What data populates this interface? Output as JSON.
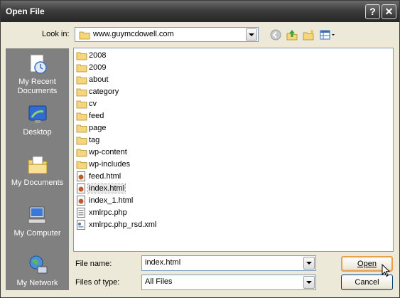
{
  "window": {
    "title": "Open File",
    "help_glyph": "?",
    "close_glyph": "✕"
  },
  "lookin": {
    "label": "Look in:",
    "value": "www.guymcdowell.com"
  },
  "toolbar": {
    "icons": [
      "back-icon",
      "up-folder-icon",
      "new-folder-icon",
      "views-menu-icon"
    ]
  },
  "places": [
    {
      "label_line1": "My Recent",
      "label_line2": "Documents",
      "icon": "recent-documents-icon"
    },
    {
      "label_line1": "Desktop",
      "label_line2": "",
      "icon": "desktop-icon"
    },
    {
      "label_line1": "My Documents",
      "label_line2": "",
      "icon": "my-documents-icon"
    },
    {
      "label_line1": "My Computer",
      "label_line2": "",
      "icon": "my-computer-icon"
    },
    {
      "label_line1": "My Network",
      "label_line2": "",
      "icon": "my-network-icon"
    }
  ],
  "files": [
    {
      "name": "2008",
      "type": "folder"
    },
    {
      "name": "2009",
      "type": "folder"
    },
    {
      "name": "about",
      "type": "folder"
    },
    {
      "name": "category",
      "type": "folder"
    },
    {
      "name": "cv",
      "type": "folder"
    },
    {
      "name": "feed",
      "type": "folder"
    },
    {
      "name": "page",
      "type": "folder"
    },
    {
      "name": "tag",
      "type": "folder"
    },
    {
      "name": "wp-content",
      "type": "folder"
    },
    {
      "name": "wp-includes",
      "type": "folder"
    },
    {
      "name": "feed.html",
      "type": "html"
    },
    {
      "name": "index.html",
      "type": "html",
      "selected": true
    },
    {
      "name": "index_1.html",
      "type": "html"
    },
    {
      "name": "xmlrpc.php",
      "type": "php"
    },
    {
      "name": "xmlrpc.php_rsd.xml",
      "type": "xml"
    }
  ],
  "filename": {
    "label": "File name:",
    "value": "index.html"
  },
  "filetype": {
    "label": "Files of type:",
    "value": "All Files"
  },
  "buttons": {
    "open": "Open",
    "cancel": "Cancel"
  },
  "colors": {
    "titlebar": "#2b2b2b",
    "dialog_bg": "#ece9d8",
    "places_bg": "#808080",
    "folder": "#f5d67a",
    "default_button_border": "#e8a04b"
  }
}
